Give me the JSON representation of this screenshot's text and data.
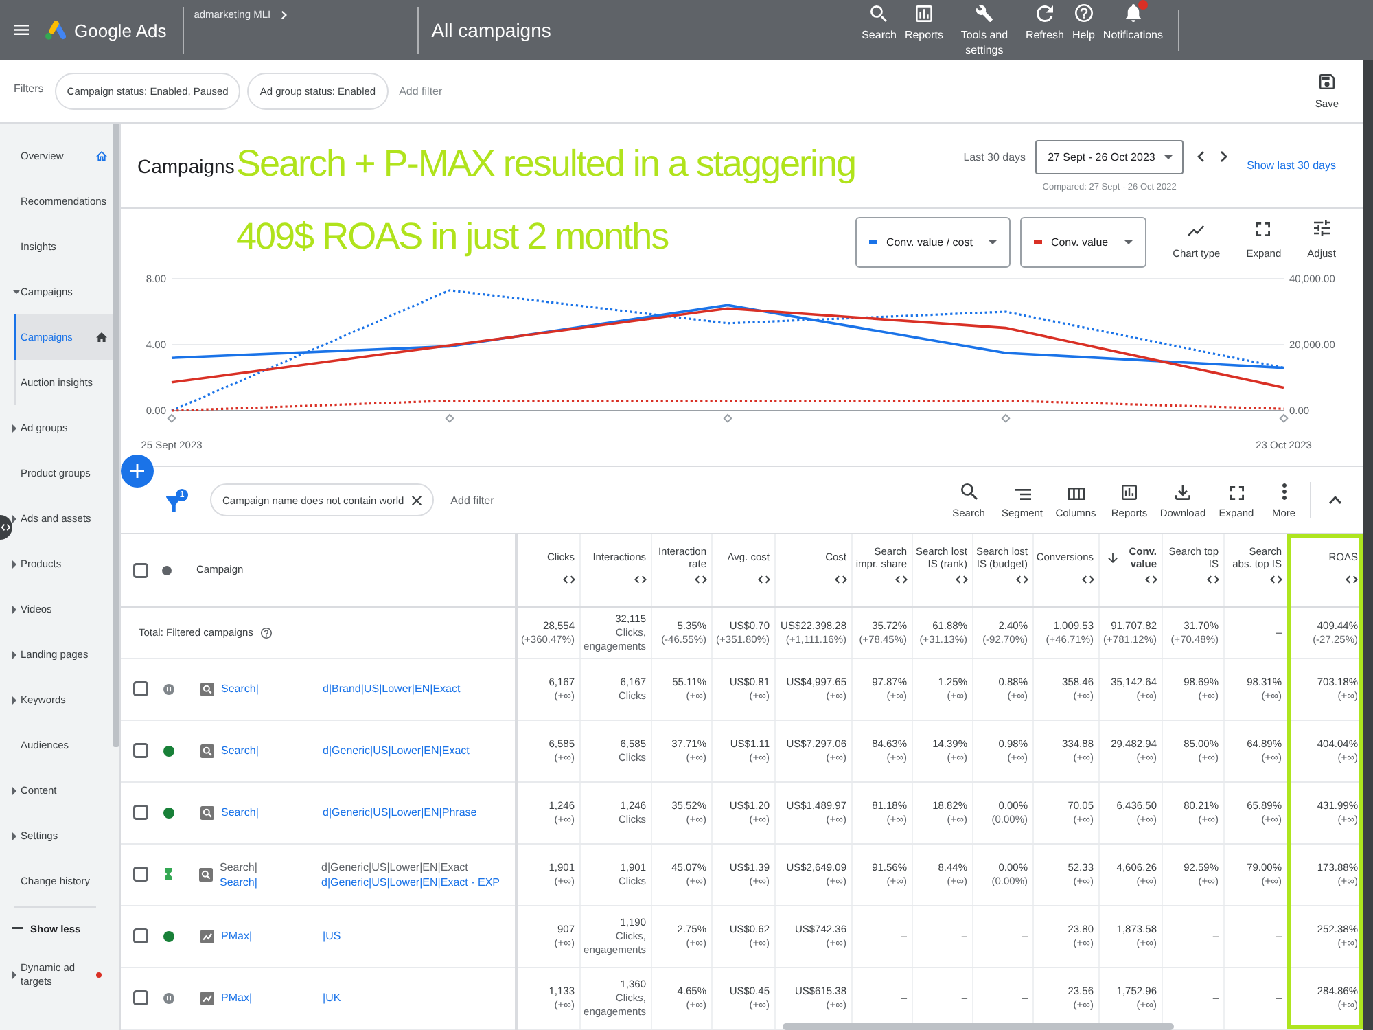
{
  "top_bar": {
    "product": "Google Ads",
    "account": "admarketing MLI",
    "page_title": "All campaigns",
    "actions": [
      {
        "label": "Search",
        "badge": false
      },
      {
        "label": "Reports",
        "badge": false
      },
      {
        "label": "Tools and settings",
        "badge": false
      },
      {
        "label": "Refresh",
        "badge": false
      },
      {
        "label": "Help",
        "badge": false
      },
      {
        "label": "Notifications",
        "badge": true
      }
    ]
  },
  "filter_bar": {
    "label": "Filters",
    "chips": [
      "Campaign status: Enabled, Paused",
      "Ad group status: Enabled"
    ],
    "add_filter": "Add filter",
    "save": "Save"
  },
  "sidebar": {
    "items": [
      {
        "label": "Overview",
        "selected": false,
        "home": true
      },
      {
        "label": "Recommendations",
        "selected": false
      },
      {
        "label": "Insights",
        "selected": false
      },
      {
        "label": "Campaigns",
        "selected": false,
        "expanded": true,
        "children": [
          {
            "label": "Campaigns",
            "selected": true,
            "home": true
          },
          {
            "label": "Auction insights",
            "selected": false
          }
        ]
      },
      {
        "label": "Ad groups",
        "selected": false,
        "expanded": false
      },
      {
        "label": "Product groups",
        "selected": false
      },
      {
        "label": "Ads and assets",
        "selected": false,
        "expanded": false
      },
      {
        "label": "Products",
        "selected": false,
        "expanded": false
      },
      {
        "label": "Videos",
        "selected": false,
        "expanded": false
      },
      {
        "label": "Landing pages",
        "selected": false,
        "expanded": false
      },
      {
        "label": "Keywords",
        "selected": false,
        "expanded": false
      },
      {
        "label": "Audiences",
        "selected": false
      },
      {
        "label": "Content",
        "selected": false,
        "expanded": false
      },
      {
        "label": "Settings",
        "selected": false,
        "expanded": false
      },
      {
        "label": "Change history",
        "selected": false
      }
    ],
    "toggle": "Show less",
    "extra_items": [
      {
        "label": "Dynamic ad targets",
        "selected": false,
        "expanded": false,
        "alert": true
      }
    ]
  },
  "header": {
    "title": "Campaigns",
    "annotation": [
      "Search + P-MAX resulted in a staggering",
      "409$ ROAS in just 2 months"
    ],
    "date": {
      "label": "Last 30 days",
      "range": "27 Sept - 26 Oct 2023",
      "compared": "Compared: 27 Sept - 26 Oct 2022",
      "link": "Show last 30 days"
    }
  },
  "chart": {
    "tools": [
      "Chart type",
      "Expand",
      "Adjust"
    ],
    "chart_data": {
      "type": "line",
      "categories": [
        "25 Sept 2023",
        null,
        null,
        null,
        "23 Oct 2023"
      ],
      "ylim": [
        0,
        8
      ],
      "yticks": [
        {
          "value": 0,
          "label": "0.00"
        },
        {
          "value": 4,
          "label": "4.00"
        },
        {
          "value": 8,
          "label": "8.00"
        }
      ],
      "y2lim": [
        0,
        40000
      ],
      "y2ticks": [
        {
          "value": 0,
          "label": "0.00"
        },
        {
          "value": 20000,
          "label": "20,000.00"
        },
        {
          "value": 40000,
          "label": "40,000.00"
        }
      ],
      "series": [
        {
          "name": "Conv. value / cost",
          "color": "#1a73e8",
          "line_style": "solid",
          "values": [
            3.2,
            3.9,
            6.4,
            3.5,
            2.6
          ]
        },
        {
          "name": "Conv. value",
          "color": "#d93025",
          "axis": "y2",
          "line_style": "solid",
          "values": [
            8600,
            19800,
            31000,
            25100,
            7000
          ]
        },
        {
          "color": "#1a73e8",
          "line_style": "dotted",
          "values": [
            0,
            7.3,
            5.3,
            6.0,
            2.6
          ]
        },
        {
          "color": "#d93025",
          "axis": "y2",
          "line_style": "dotted",
          "values": [
            0,
            3000,
            3000,
            3000,
            600
          ]
        }
      ]
    }
  },
  "table": {
    "filter_count": "1",
    "filter_chip": "Campaign name does not contain world",
    "add_filter": "Add filter",
    "tools": [
      "Search",
      "Segment",
      "Columns",
      "Reports",
      "Download",
      "Expand",
      "More"
    ],
    "campaign_column": {
      "label": "Campaign",
      "checked": false
    },
    "columns": [
      {
        "label": "Clicks",
        "sorted": false,
        "highlighted": false
      },
      {
        "label": "Interactions",
        "sorted": false,
        "highlighted": false
      },
      {
        "label": "Interaction rate",
        "sorted": false,
        "highlighted": false
      },
      {
        "label": "Avg. cost",
        "sorted": false,
        "highlighted": false
      },
      {
        "label": "Cost",
        "sorted": false,
        "highlighted": false
      },
      {
        "label": "Search impr. share",
        "sorted": false,
        "highlighted": false
      },
      {
        "label": "Search lost IS (rank)",
        "sorted": false,
        "highlighted": false
      },
      {
        "label": "Search lost IS (budget)",
        "sorted": false,
        "highlighted": false
      },
      {
        "label": "Conversions",
        "sorted": false,
        "highlighted": false
      },
      {
        "label": "Conv. value",
        "sorted": true,
        "highlighted": false
      },
      {
        "label": "Search top IS",
        "sorted": false,
        "highlighted": false
      },
      {
        "label": "Search abs. top IS",
        "sorted": false,
        "highlighted": false
      },
      {
        "label": "ROAS",
        "sorted": false,
        "highlighted": true
      }
    ],
    "total": {
      "label": "Total: Filtered campaigns",
      "cells": [
        {
          "value": "28,554",
          "note": "(+360.47%)"
        },
        {
          "value": "32,115",
          "note": "Clicks, engagements"
        },
        {
          "value": "5.35%",
          "note": "(-46.55%)"
        },
        {
          "value": "US$0.70",
          "note": "(+351.80%)"
        },
        {
          "value": "US$22,398.28",
          "note": "(+1,111.16%)"
        },
        {
          "value": "35.72%",
          "note": "(+78.45%)"
        },
        {
          "value": "61.88%",
          "note": "(+31.13%)"
        },
        {
          "value": "2.40%",
          "note": "(-92.70%)"
        },
        {
          "value": "1,009.53",
          "note": "(+46.71%)"
        },
        {
          "value": "91,707.82",
          "note": "(+781.12%)"
        },
        {
          "value": "31.70%",
          "note": "(+70.48%)"
        },
        {
          "value": "–"
        },
        {
          "value": "409.44%",
          "note": "(-27.25%)"
        }
      ]
    },
    "rows": [
      {
        "checked": false,
        "kind": "search",
        "status": {
          "kind": "paused"
        },
        "name": [
          {
            "start": "Search|",
            "end": "d|Brand|US|Lower|EN|Exact",
            "link": true
          }
        ],
        "cells": [
          {
            "value": "6,167",
            "note": "(+∞)"
          },
          {
            "value": "6,167",
            "note": "Clicks"
          },
          {
            "value": "55.11%",
            "note": "(+∞)"
          },
          {
            "value": "US$0.81",
            "note": "(+∞)"
          },
          {
            "value": "US$4,997.65",
            "note": "(+∞)"
          },
          {
            "value": "97.87%",
            "note": "(+∞)"
          },
          {
            "value": "1.25%",
            "note": "(+∞)"
          },
          {
            "value": "0.88%",
            "note": "(+∞)"
          },
          {
            "value": "358.46",
            "note": "(+∞)"
          },
          {
            "value": "35,142.64",
            "note": "(+∞)"
          },
          {
            "value": "98.69%",
            "note": "(+∞)"
          },
          {
            "value": "98.31%",
            "note": "(+∞)"
          },
          {
            "value": "703.18%",
            "note": "(+∞)"
          }
        ]
      },
      {
        "checked": false,
        "kind": "search",
        "status": {
          "kind": "enabled"
        },
        "name": [
          {
            "start": "Search|",
            "end": "d|Generic|US|Lower|EN|Exact",
            "link": true
          }
        ],
        "cells": [
          {
            "value": "6,585",
            "note": "(+∞)"
          },
          {
            "value": "6,585",
            "note": "Clicks"
          },
          {
            "value": "37.71%",
            "note": "(+∞)"
          },
          {
            "value": "US$1.11",
            "note": "(+∞)"
          },
          {
            "value": "US$7,297.06",
            "note": "(+∞)"
          },
          {
            "value": "84.63%",
            "note": "(+∞)"
          },
          {
            "value": "14.39%",
            "note": "(+∞)"
          },
          {
            "value": "0.98%",
            "note": "(+∞)"
          },
          {
            "value": "334.88",
            "note": "(+∞)"
          },
          {
            "value": "29,482.94",
            "note": "(+∞)"
          },
          {
            "value": "85.00%",
            "note": "(+∞)"
          },
          {
            "value": "64.89%",
            "note": "(+∞)"
          },
          {
            "value": "404.04%",
            "note": "(+∞)"
          }
        ]
      },
      {
        "checked": false,
        "kind": "search",
        "status": {
          "kind": "enabled"
        },
        "name": [
          {
            "start": "Search|",
            "end": "d|Generic|US|Lower|EN|Phrase",
            "link": true
          }
        ],
        "cells": [
          {
            "value": "1,246",
            "note": "(+∞)"
          },
          {
            "value": "1,246",
            "note": "Clicks"
          },
          {
            "value": "35.52%",
            "note": "(+∞)"
          },
          {
            "value": "US$1.20",
            "note": "(+∞)"
          },
          {
            "value": "US$1,489.97",
            "note": "(+∞)"
          },
          {
            "value": "81.18%",
            "note": "(+∞)"
          },
          {
            "value": "18.82%",
            "note": "(+∞)"
          },
          {
            "value": "0.00%",
            "note": "(0.00%)"
          },
          {
            "value": "70.05",
            "note": "(+∞)"
          },
          {
            "value": "6,436.50",
            "note": "(+∞)"
          },
          {
            "value": "80.21%",
            "note": "(+∞)"
          },
          {
            "value": "65.89%",
            "note": "(+∞)"
          },
          {
            "value": "431.99%",
            "note": "(+∞)"
          }
        ]
      },
      {
        "checked": false,
        "kind": "search",
        "status": {
          "kind": "experiment"
        },
        "name": [
          {
            "start": "Search|",
            "end": "d|Generic|US|Lower|EN|Exact",
            "link": false
          },
          {
            "start": "Search|",
            "end": "d|Generic|US|Lower|EN|Exact - EXP",
            "link": true
          }
        ],
        "cells": [
          {
            "value": "1,901",
            "note": "(+∞)"
          },
          {
            "value": "1,901",
            "note": "Clicks"
          },
          {
            "value": "45.07%",
            "note": "(+∞)"
          },
          {
            "value": "US$1.39",
            "note": "(+∞)"
          },
          {
            "value": "US$2,649.09",
            "note": "(+∞)"
          },
          {
            "value": "91.56%",
            "note": "(+∞)"
          },
          {
            "value": "8.44%",
            "note": "(+∞)"
          },
          {
            "value": "0.00%",
            "note": "(0.00%)"
          },
          {
            "value": "52.33",
            "note": "(+∞)"
          },
          {
            "value": "4,606.26",
            "note": "(+∞)"
          },
          {
            "value": "92.59%",
            "note": "(+∞)"
          },
          {
            "value": "79.00%",
            "note": "(+∞)"
          },
          {
            "value": "173.88%",
            "note": "(+∞)"
          }
        ]
      },
      {
        "checked": false,
        "kind": "pmax",
        "status": {
          "kind": "enabled"
        },
        "name": [
          {
            "start": "PMax|",
            "end": "|US",
            "link": true
          }
        ],
        "cells": [
          {
            "value": "907",
            "note": "(+∞)"
          },
          {
            "value": "1,190",
            "note": "Clicks, engagements"
          },
          {
            "value": "2.75%",
            "note": "(+∞)"
          },
          {
            "value": "US$0.62",
            "note": "(+∞)"
          },
          {
            "value": "US$742.36",
            "note": "(+∞)"
          },
          {
            "value": "–"
          },
          {
            "value": "–"
          },
          {
            "value": "–"
          },
          {
            "value": "23.80",
            "note": "(+∞)"
          },
          {
            "value": "1,873.58",
            "note": "(+∞)"
          },
          {
            "value": "–"
          },
          {
            "value": "–"
          },
          {
            "value": "252.38%",
            "note": "(+∞)"
          }
        ]
      },
      {
        "checked": false,
        "kind": "pmax",
        "status": {
          "kind": "paused"
        },
        "name": [
          {
            "start": "PMax|",
            "end": "|UK",
            "link": true
          }
        ],
        "cells": [
          {
            "value": "1,133",
            "note": "(+∞)"
          },
          {
            "value": "1,360",
            "note": "Clicks, engagements"
          },
          {
            "value": "4.65%",
            "note": "(+∞)"
          },
          {
            "value": "US$0.45",
            "note": "(+∞)"
          },
          {
            "value": "US$615.38",
            "note": "(+∞)"
          },
          {
            "value": "–"
          },
          {
            "value": "–"
          },
          {
            "value": "–"
          },
          {
            "value": "23.56",
            "note": "(+∞)"
          },
          {
            "value": "1,752.96",
            "note": "(+∞)"
          },
          {
            "value": "–"
          },
          {
            "value": "–"
          },
          {
            "value": "284.86%",
            "note": "(+∞)"
          }
        ]
      }
    ]
  }
}
